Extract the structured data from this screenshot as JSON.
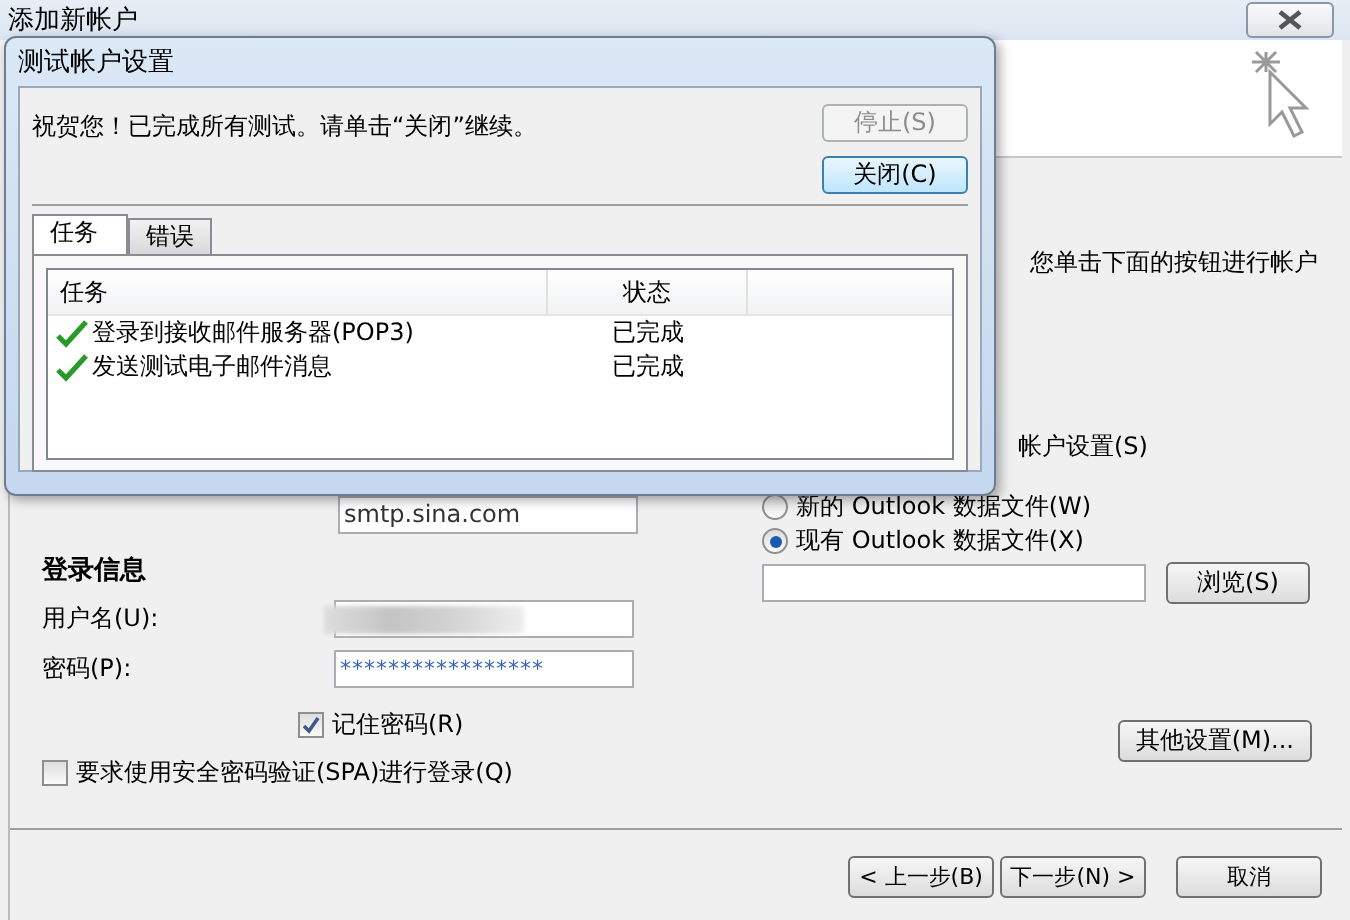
{
  "window": {
    "title": "添加新帐户"
  },
  "background_texts": [
    "您单击下面的按钮进行帐户",
    "帐户设置(S)"
  ],
  "smtp_field": {
    "value": "smtp.sina.com"
  },
  "login": {
    "heading": "登录信息",
    "fields": [
      {
        "label": "用户名(U):",
        "kind": "blurred"
      },
      {
        "label": "密码(P):",
        "kind": "password",
        "value": "*****************"
      }
    ]
  },
  "remember_password": {
    "label": "记住密码(R)",
    "checked": true
  },
  "spa": {
    "label": "要求使用安全密码验证(SPA)进行登录(Q)",
    "checked": false
  },
  "data_file_options": [
    {
      "label": "新的 Outlook 数据文件(W)",
      "selected": false
    },
    {
      "label": "现有 Outlook 数据文件(X)",
      "selected": true
    }
  ],
  "browse_button": "浏览(S)",
  "more_settings_button": "其他设置(M)...",
  "nav_buttons": [
    "< 上一步(B)",
    "下一步(N) >",
    "取消"
  ],
  "dialog": {
    "title": "测试帐户设置",
    "message": "祝贺您！已完成所有测试。请单击“关闭”继续。",
    "buttons": [
      {
        "label": "停止(S)",
        "disabled": true
      },
      {
        "label": "关闭(C)",
        "disabled": false
      }
    ],
    "tabs": [
      {
        "label": "任务",
        "selected": true
      },
      {
        "label": "错误",
        "selected": false
      }
    ],
    "columns": [
      "任务",
      "状态"
    ],
    "rows": [
      {
        "task": "登录到接收邮件服务器(POP3)",
        "status": "已完成",
        "done": true
      },
      {
        "task": "发送测试电子邮件消息",
        "status": "已完成",
        "done": true
      }
    ]
  }
}
